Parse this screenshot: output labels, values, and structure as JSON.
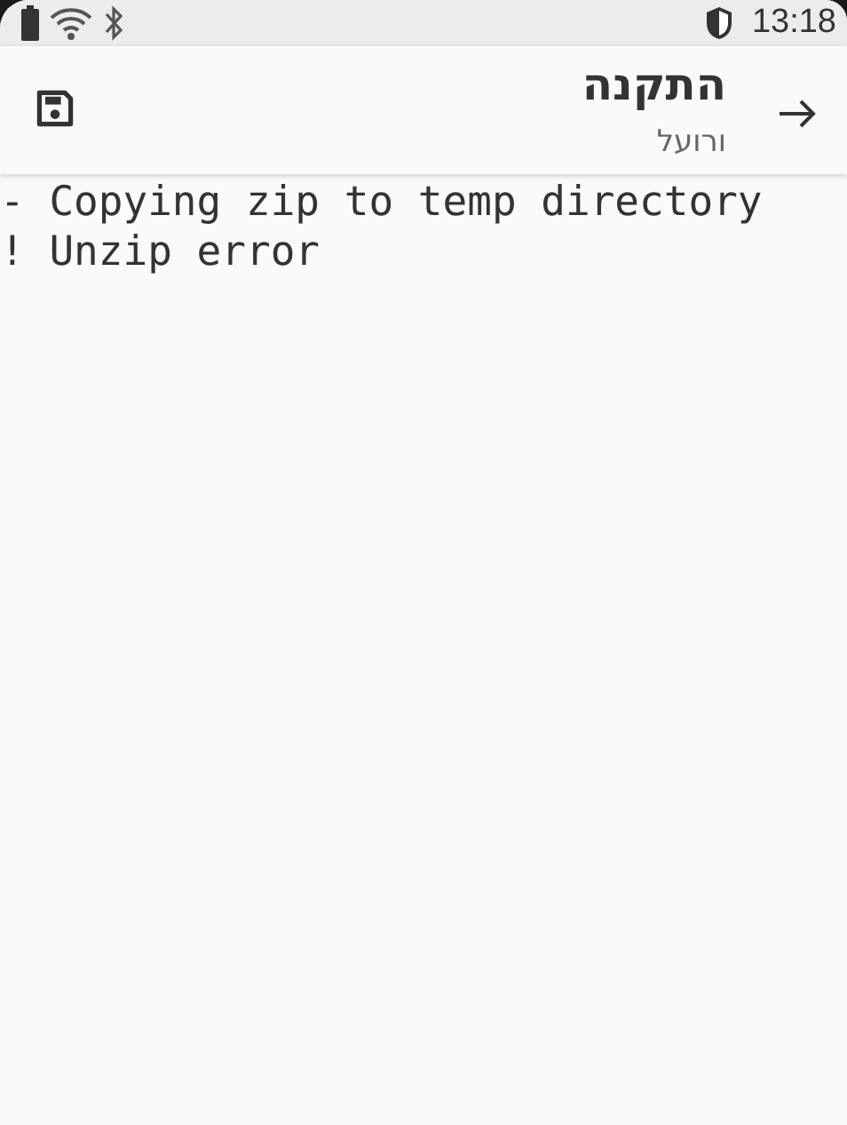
{
  "status_bar": {
    "time": "13:18"
  },
  "toolbar": {
    "title": "התקנה",
    "subtitle": "ורועל"
  },
  "log": [
    "- Copying zip to temp directory",
    "! Unzip error"
  ]
}
